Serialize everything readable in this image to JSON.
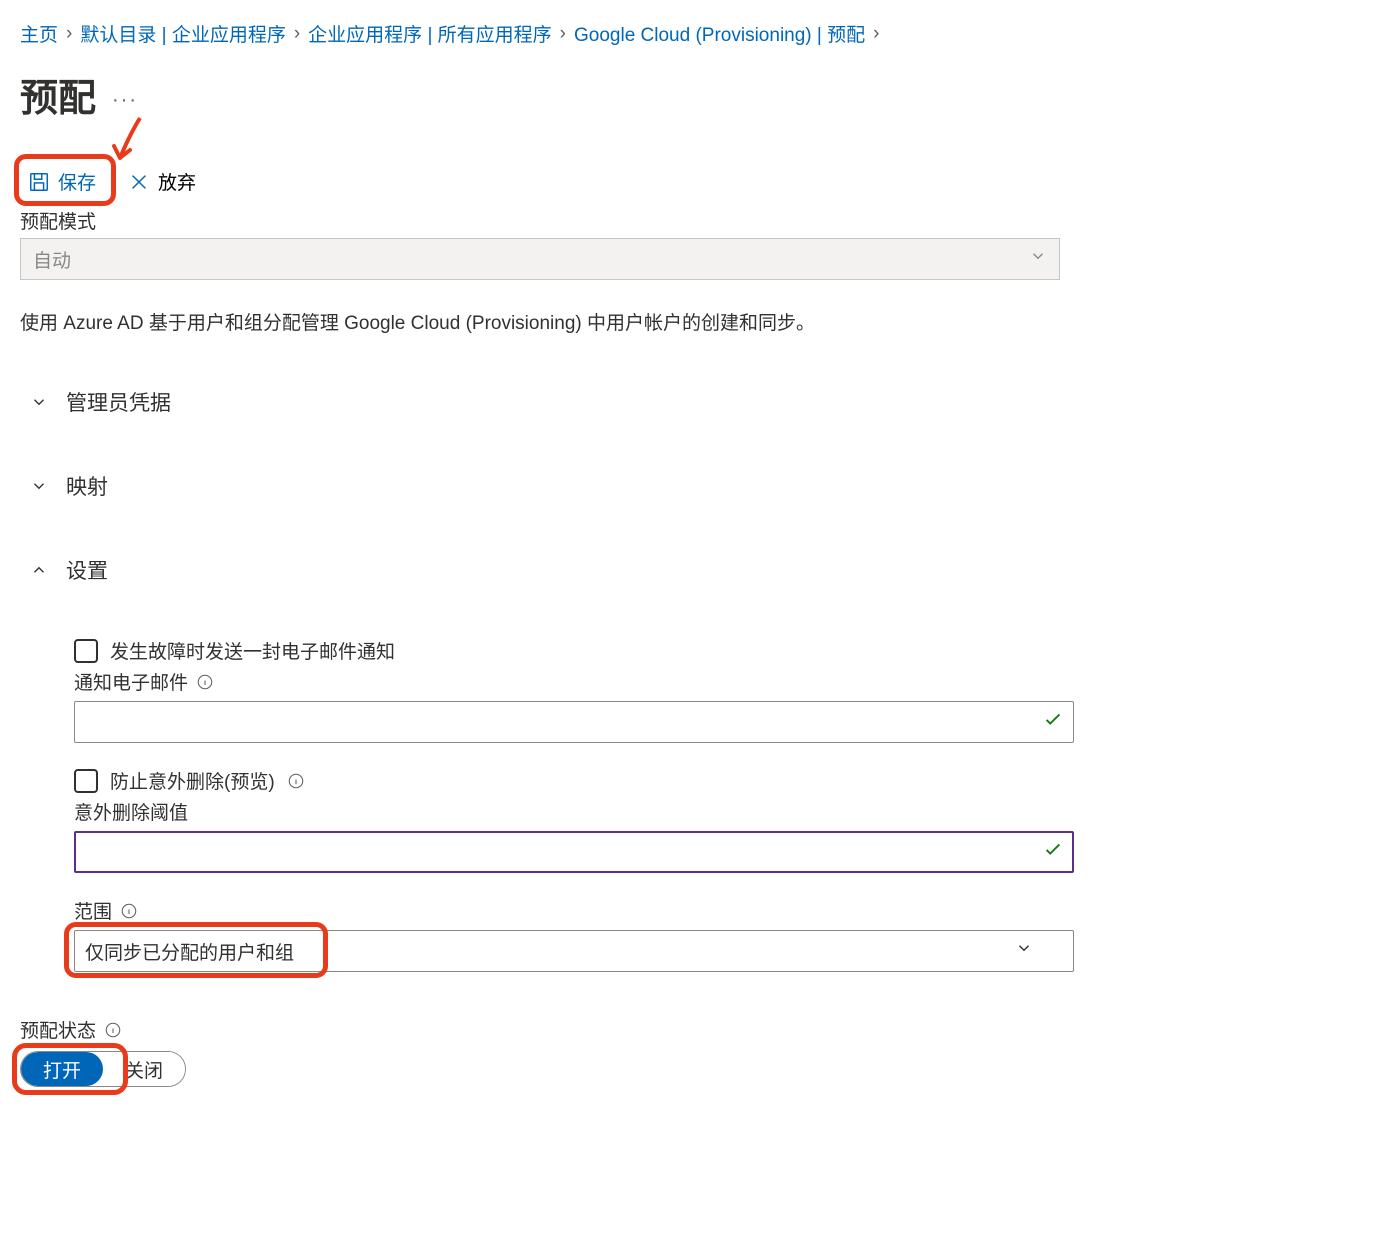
{
  "breadcrumb": {
    "home": "主页",
    "item1": "默认目录 | 企业应用程序",
    "item2": "企业应用程序 | 所有应用程序",
    "item3": "Google Cloud (Provisioning) | 预配"
  },
  "page": {
    "title": "预配",
    "more": "···"
  },
  "toolbar": {
    "save_label": "保存",
    "discard_label": "放弃"
  },
  "mode": {
    "label": "预配模式",
    "value": "自动"
  },
  "description": "使用 Azure AD 基于用户和组分配管理 Google Cloud (Provisioning) 中用户帐户的创建和同步。",
  "sections": {
    "admin_credentials": "管理员凭据",
    "mappings": "映射",
    "settings": "设置"
  },
  "settings": {
    "failure_email_checkbox": "发生故障时发送一封电子邮件通知",
    "notification_email_label": "通知电子邮件",
    "notification_email_value": "",
    "prevent_accidental_delete_checkbox": "防止意外删除(预览)",
    "accidental_delete_threshold_label": "意外删除阈值",
    "accidental_delete_threshold_value": "",
    "scope_label": "范围",
    "scope_value": "仅同步已分配的用户和组"
  },
  "status": {
    "label": "预配状态",
    "on": "打开",
    "off": "关闭"
  }
}
